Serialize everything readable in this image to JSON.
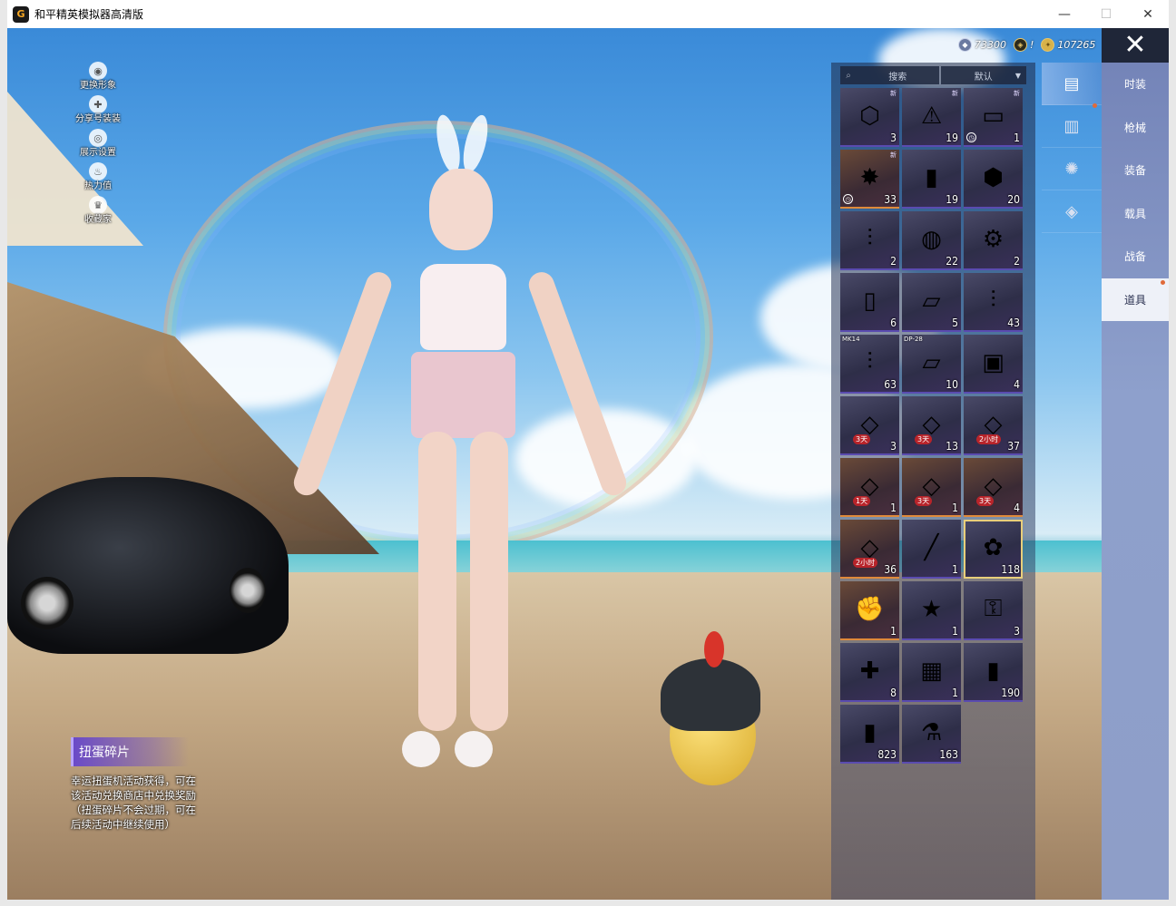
{
  "window": {
    "title": "和平精英模拟器高清版",
    "logo_glyph": "G",
    "minimize": "—",
    "maximize": "☐",
    "close": "✕"
  },
  "left_menu": [
    {
      "label": "更换形象",
      "icon": "person-icon",
      "glyph": "◉"
    },
    {
      "label": "分享号装装",
      "icon": "share-icon",
      "glyph": "✚"
    },
    {
      "label": "展示设置",
      "icon": "eye-icon",
      "glyph": "◎"
    },
    {
      "label": "热力值",
      "icon": "fire-icon",
      "glyph": "♨"
    },
    {
      "label": "收藏家",
      "icon": "trophy-icon",
      "glyph": "♛"
    }
  ],
  "currencies": [
    {
      "icon": "silver-coin-icon",
      "glyph": "◆",
      "value": "73300",
      "color": "silver"
    },
    {
      "icon": "token-icon",
      "glyph": "◈",
      "value": "!",
      "color": "gold-dark"
    },
    {
      "icon": "gold-coin-icon",
      "glyph": "✦",
      "value": "107265",
      "color": "gold"
    }
  ],
  "close_button": "✕",
  "inventory": {
    "search_placeholder": "搜索",
    "sort_label": "默认",
    "items": [
      {
        "glyph": "⬡",
        "count": "3",
        "tag": "",
        "new": "新",
        "style": "normal"
      },
      {
        "glyph": "⚠",
        "count": "19",
        "tag": "",
        "new": "新",
        "style": "normal"
      },
      {
        "glyph": "▭",
        "count": "1",
        "tag": "",
        "new": "新",
        "style": "normal",
        "timer": true
      },
      {
        "glyph": "✸",
        "count": "33",
        "tag": "",
        "new": "新",
        "style": "orange",
        "timer": true
      },
      {
        "glyph": "▮",
        "count": "19",
        "tag": "",
        "new": "",
        "style": "normal"
      },
      {
        "glyph": "⬢",
        "count": "20",
        "tag": "",
        "new": "",
        "style": "normal"
      },
      {
        "glyph": "⫶",
        "count": "2",
        "tag": "",
        "new": "",
        "style": "normal"
      },
      {
        "glyph": "◍",
        "count": "22",
        "tag": "",
        "new": "",
        "style": "normal"
      },
      {
        "glyph": "⚙",
        "count": "2",
        "tag": "",
        "new": "",
        "style": "normal"
      },
      {
        "glyph": "▯",
        "count": "6",
        "tag": "",
        "new": "",
        "style": "normal"
      },
      {
        "glyph": "▱",
        "count": "5",
        "tag": "",
        "new": "",
        "style": "normal"
      },
      {
        "glyph": "⫶",
        "count": "43",
        "tag": "",
        "new": "",
        "style": "normal"
      },
      {
        "glyph": "⫶",
        "count": "63",
        "tag": "MK14",
        "new": "",
        "style": "normal"
      },
      {
        "glyph": "▱",
        "count": "10",
        "tag": "DP-28",
        "new": "",
        "style": "normal"
      },
      {
        "glyph": "▣",
        "count": "4",
        "tag": "",
        "new": "",
        "style": "normal"
      },
      {
        "glyph": "◇",
        "count": "3",
        "tag": "",
        "new": "",
        "style": "normal",
        "ticket": "3天"
      },
      {
        "glyph": "◇",
        "count": "13",
        "tag": "",
        "new": "",
        "style": "normal",
        "ticket": "3天"
      },
      {
        "glyph": "◇",
        "count": "37",
        "tag": "",
        "new": "",
        "style": "normal",
        "ticket": "2小时"
      },
      {
        "glyph": "◇",
        "count": "1",
        "tag": "",
        "new": "",
        "style": "orange",
        "ticket": "1天"
      },
      {
        "glyph": "◇",
        "count": "1",
        "tag": "",
        "new": "",
        "style": "orange",
        "ticket": "3天"
      },
      {
        "glyph": "◇",
        "count": "4",
        "tag": "",
        "new": "",
        "style": "orange",
        "ticket": "3天"
      },
      {
        "glyph": "◇",
        "count": "36",
        "tag": "",
        "new": "",
        "style": "orange",
        "ticket": "2小时"
      },
      {
        "glyph": "╱",
        "count": "1",
        "tag": "",
        "new": "",
        "style": "normal"
      },
      {
        "glyph": "✿",
        "count": "118",
        "tag": "",
        "new": "",
        "style": "normal",
        "selected": true
      },
      {
        "glyph": "✊",
        "count": "1",
        "tag": "",
        "new": "",
        "style": "orange"
      },
      {
        "glyph": "★",
        "count": "1",
        "tag": "",
        "new": "",
        "style": "normal"
      },
      {
        "glyph": "⚿",
        "count": "3",
        "tag": "",
        "new": "",
        "style": "normal"
      },
      {
        "glyph": "✚",
        "count": "8",
        "tag": "",
        "new": "",
        "style": "normal"
      },
      {
        "glyph": "▦",
        "count": "1",
        "tag": "",
        "new": "",
        "style": "normal"
      },
      {
        "glyph": "▮",
        "count": "190",
        "tag": "",
        "new": "",
        "style": "normal"
      },
      {
        "glyph": "▮",
        "count": "823",
        "tag": "",
        "new": "",
        "style": "normal"
      },
      {
        "glyph": "⚗",
        "count": "163",
        "tag": "",
        "new": "",
        "style": "normal"
      }
    ]
  },
  "icon_tabs": [
    {
      "name": "clothing-card-icon",
      "glyph": "▤",
      "active": true,
      "dot": true
    },
    {
      "name": "chest-icon",
      "glyph": "▥",
      "active": false,
      "dot": false
    },
    {
      "name": "firework-icon",
      "glyph": "✺",
      "active": false,
      "dot": false
    },
    {
      "name": "ticket-icon",
      "glyph": "◈",
      "active": false,
      "dot": false
    }
  ],
  "category_tabs": [
    {
      "label": "时装",
      "active": false,
      "dot": false
    },
    {
      "label": "枪械",
      "active": false,
      "dot": false
    },
    {
      "label": "装备",
      "active": false,
      "dot": false
    },
    {
      "label": "载具",
      "active": false,
      "dot": false
    },
    {
      "label": "战备",
      "active": false,
      "dot": false
    },
    {
      "label": "道具",
      "active": true,
      "dot": true
    }
  ],
  "item_detail": {
    "title": "扭蛋碎片",
    "description": "幸运扭蛋机活动获得，可在该活动兑换商店中兑换奖励（扭蛋碎片不会过期，可在后续活动中继续使用）"
  }
}
